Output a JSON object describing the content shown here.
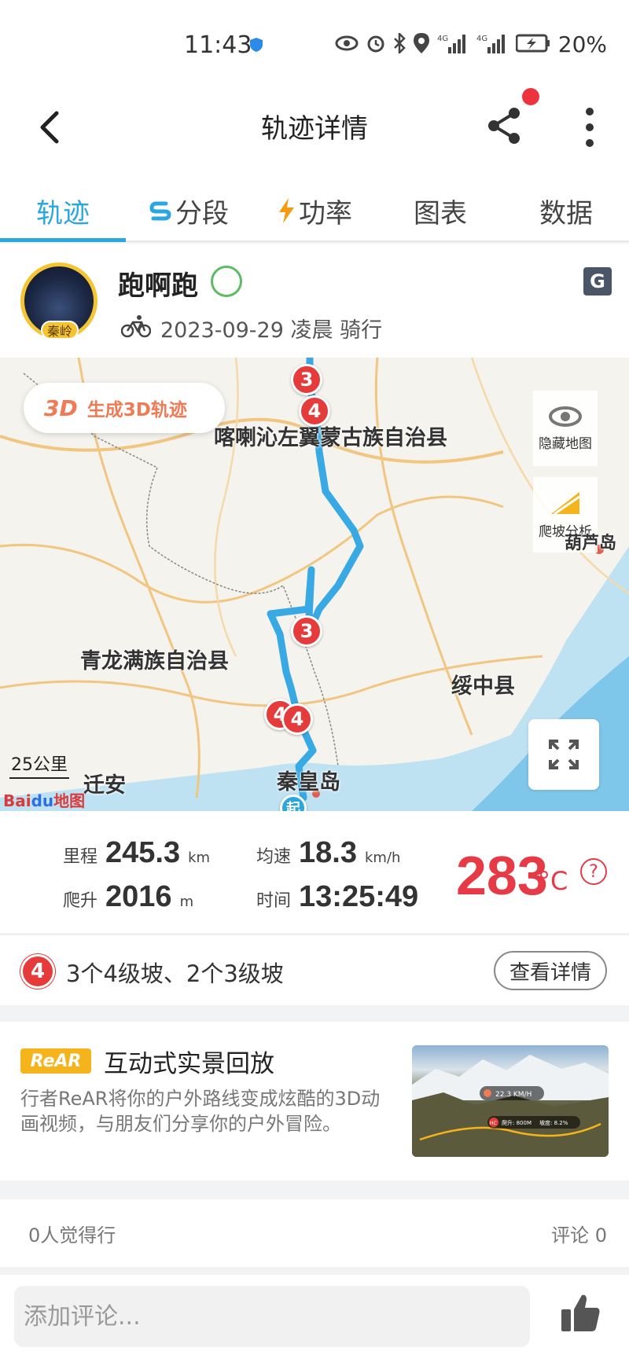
{
  "status": {
    "time": "11:43",
    "battery": "20%"
  },
  "header": {
    "title": "轨迹详情"
  },
  "tabs": [
    {
      "label": "轨迹"
    },
    {
      "label": "分段"
    },
    {
      "label": "功率"
    },
    {
      "label": "图表"
    },
    {
      "label": "数据"
    }
  ],
  "profile": {
    "name": "跑啊跑",
    "avatar_badge": "秦岭",
    "date": "2023-09-29",
    "time_of_day": "凌晨",
    "activity": "骑行",
    "g_badge": "G"
  },
  "map": {
    "btn_3d_icon": "3D",
    "btn_3d_label": "生成3D轨迹",
    "hide_map_label": "隐藏地图",
    "slope_label": "爬坡分析",
    "places": [
      "喀喇沁左翼蒙古族自治县",
      "青龙满族自治县",
      "绥中县",
      "迁安",
      "秦皇岛",
      "葫芦岛"
    ],
    "markers": [
      "3",
      "4",
      "3",
      "4",
      "4"
    ],
    "start_marker": "起",
    "scale": "25公里",
    "baidu_bai": "Bai",
    "baidu_du": "du",
    "baidu_map": "地图"
  },
  "stats": {
    "distance": {
      "label": "里程",
      "value": "245.3",
      "unit": "km"
    },
    "avg_speed": {
      "label": "均速",
      "value": "18.3",
      "unit": "km/h"
    },
    "climb": {
      "label": "爬升",
      "value": "2016",
      "unit": "m"
    },
    "duration": {
      "label": "时间",
      "value": "13:25:49"
    },
    "temperature": {
      "value": "283",
      "unit": "°C"
    },
    "help": "?"
  },
  "climb_summary": {
    "badge": "4",
    "text": "3个4级坡、2个3级坡",
    "button": "查看详情"
  },
  "rear": {
    "logo": "ReAR",
    "title": "互动式实景回放",
    "description": "行者ReAR将你的户外路线变成炫酷的3D动画视频，与朋友们分享你的户外冒险。",
    "thumb_speed": "22.3 KM/H",
    "thumb_badge": "HC",
    "thumb_climb": "爬升: 800M",
    "thumb_slope": "坡度: 8.2%"
  },
  "social": {
    "likes": "0人觉得行",
    "comments": "评论 0"
  },
  "comment": {
    "placeholder": "添加评论..."
  },
  "colors": {
    "accent": "#2aa6e0",
    "route": "#38a9e3",
    "danger": "#e63b46",
    "marker": "#e63b3b"
  }
}
